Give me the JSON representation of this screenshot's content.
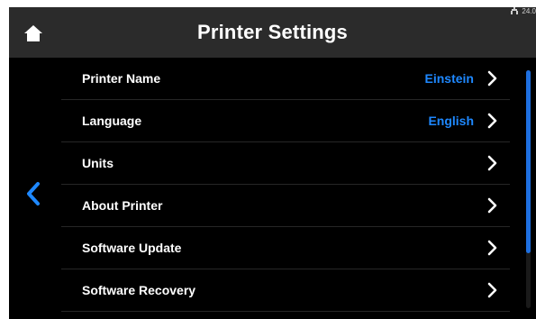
{
  "header": {
    "title": "Printer Settings",
    "status_text": "24.0",
    "icons": {
      "home": "home-icon",
      "status": "network-icon"
    }
  },
  "nav": {
    "back_icon": "chevron-left-icon"
  },
  "settings": {
    "items": [
      {
        "label": "Printer Name",
        "value": "Einstein"
      },
      {
        "label": "Language",
        "value": "English"
      },
      {
        "label": "Units",
        "value": ""
      },
      {
        "label": "About Printer",
        "value": ""
      },
      {
        "label": "Software Update",
        "value": ""
      },
      {
        "label": "Software Recovery",
        "value": ""
      }
    ]
  },
  "colors": {
    "background": "#000000",
    "header": "#2b2b2b",
    "accent": "#1e88ff",
    "text": "#ffffff"
  },
  "scrollbar": {
    "visible_fraction": 0.77,
    "position": 0.0
  }
}
